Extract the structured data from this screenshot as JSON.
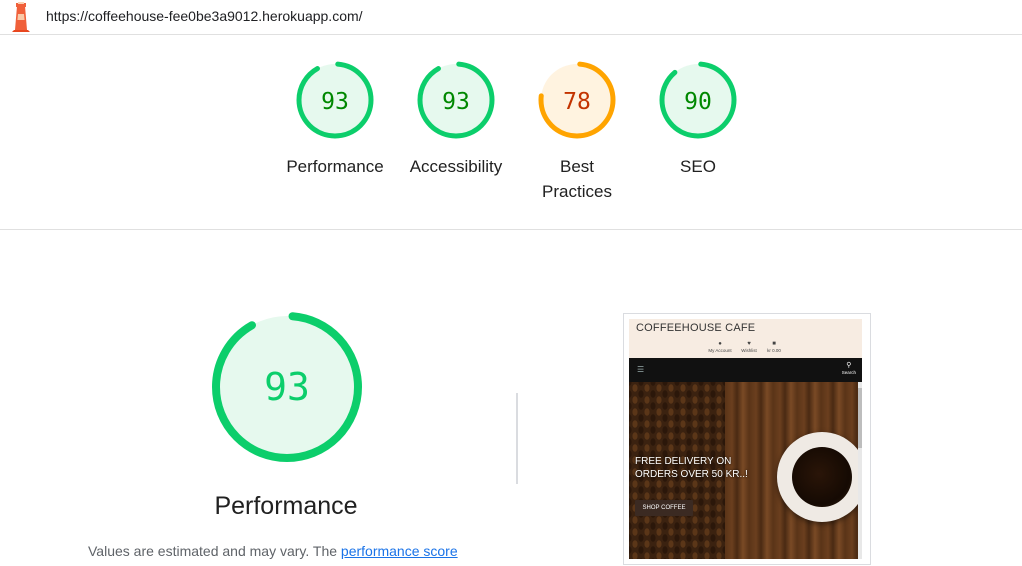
{
  "url": "https://coffeehouse-fee0be3a9012.herokuapp.com/",
  "colors": {
    "pass": "#0cce6b",
    "pass_text": "#008800",
    "pass_fill": "#e6f9ee",
    "average": "#ffa400",
    "average_text": "#c33300",
    "average_fill": "#fff3e0"
  },
  "gauges": [
    {
      "label_lines": [
        "Performance"
      ],
      "score": 93,
      "status": "pass"
    },
    {
      "label_lines": [
        "Accessibility"
      ],
      "score": 93,
      "status": "pass"
    },
    {
      "label_lines": [
        "Best",
        "Practices"
      ],
      "score": 78,
      "status": "average"
    },
    {
      "label_lines": [
        "SEO"
      ],
      "score": 90,
      "status": "pass"
    }
  ],
  "performance": {
    "score": 93,
    "title": "Performance",
    "desc_prefix": "Values are estimated and may vary. The ",
    "desc_link": "performance score"
  },
  "screenshot": {
    "site_name": "COFFEEHOUSE CAFE",
    "icons": [
      {
        "icon": "user-icon",
        "label": "My Account"
      },
      {
        "icon": "heart-icon",
        "label": "Wishlist"
      },
      {
        "icon": "bag-icon",
        "label": "kr 0.00"
      }
    ],
    "search_label": "Search",
    "hero_text": "FREE DELIVERY ON ORDERS OVER 50 KR..!",
    "hero_button": "SHOP COFFEE"
  }
}
